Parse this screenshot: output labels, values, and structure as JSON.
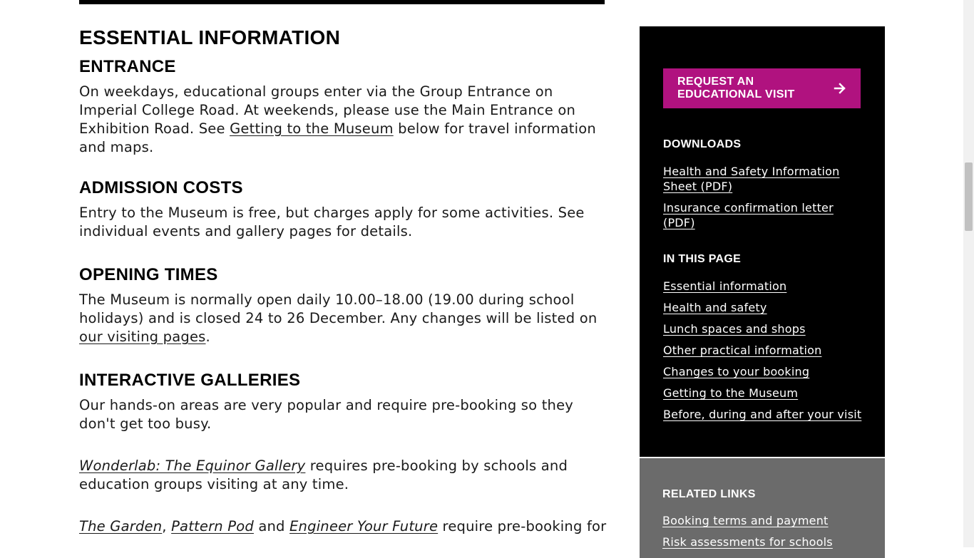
{
  "main": {
    "title": "ESSENTIAL INFORMATION",
    "entrance": {
      "heading": "ENTRANCE",
      "text1": "On weekdays, educational groups enter via the Group Entrance on Imperial College Road. At weekends, please use the Main Entrance on Exhibition Road. See ",
      "link": "Getting to the Museum",
      "text2": " below for travel information and maps."
    },
    "admission": {
      "heading": "ADMISSION COSTS",
      "text": "Entry to the Museum is free, but charges apply for some activities. See individual events and gallery pages for details."
    },
    "opening": {
      "heading": "OPENING TIMES",
      "text1": "The Museum is normally open daily 10.00–18.00 (19.00 during school holidays) and is closed 24 to 26 December. Any changes will be listed on ",
      "link": "our visiting pages",
      "text2": "."
    },
    "interactive": {
      "heading": "INTERACTIVE GALLERIES",
      "text": "Our hands-on areas are very popular and require pre-booking so they don't get too busy.",
      "wonderlab_link": "Wonderlab: The Equinor Gallery",
      "wonderlab_text": " requires pre-booking by schools and education groups visiting at any time.",
      "garden_link": "The Garden",
      "sep": ", ",
      "pattern_link": "Pattern Pod",
      "and": " and ",
      "engineer_link": "Engineer Your Future",
      "tail": " require pre-booking for"
    }
  },
  "sidebar": {
    "cta_label": "REQUEST AN EDUCATIONAL VISIT",
    "downloads_heading": "DOWNLOADS",
    "downloads": [
      "Health and Safety Information Sheet (PDF)",
      "Insurance confirmation letter (PDF)"
    ],
    "in_page_heading": "IN THIS PAGE",
    "in_page": [
      "Essential information",
      "Health and safety",
      "Lunch spaces and shops",
      "Other practical information",
      "Changes to your booking",
      "Getting to the Museum",
      "Before, during and after your visit"
    ]
  },
  "related": {
    "heading": "RELATED LINKS",
    "links": [
      "Booking terms and payment",
      "Risk assessments for schools"
    ]
  },
  "colors": {
    "cta": "#b0127f",
    "sidebar_bg": "#000000",
    "related_bg": "#6b6b6b"
  }
}
